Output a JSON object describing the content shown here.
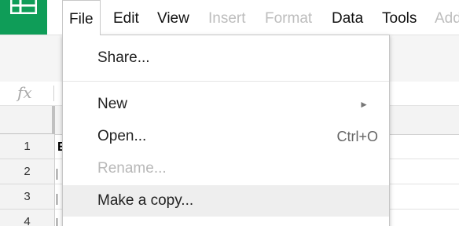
{
  "colors": {
    "brand_green": "#0f9d58",
    "menu_highlight": "#eeeeee",
    "disabled_text": "#b8b8b8"
  },
  "logo": {
    "icon": "sheets-grid-icon"
  },
  "menubar": {
    "items": [
      {
        "label": "File",
        "active": true,
        "enabled": true
      },
      {
        "label": "Edit",
        "enabled": true
      },
      {
        "label": "View",
        "enabled": true
      },
      {
        "label": "Insert",
        "enabled": false
      },
      {
        "label": "Format",
        "enabled": false
      },
      {
        "label": "Data",
        "enabled": true
      },
      {
        "label": "Tools",
        "enabled": true
      },
      {
        "label": "Add",
        "enabled": false
      }
    ]
  },
  "formula_bar": {
    "fx_label": "fx"
  },
  "grid": {
    "rows": [
      "1",
      "2",
      "3",
      "4"
    ],
    "cell_a1": "E"
  },
  "file_menu": {
    "share": "Share...",
    "new": "New",
    "new_arrow": "►",
    "open": "Open...",
    "open_shortcut": "Ctrl+O",
    "rename": "Rename...",
    "make_copy": "Make a copy..."
  }
}
